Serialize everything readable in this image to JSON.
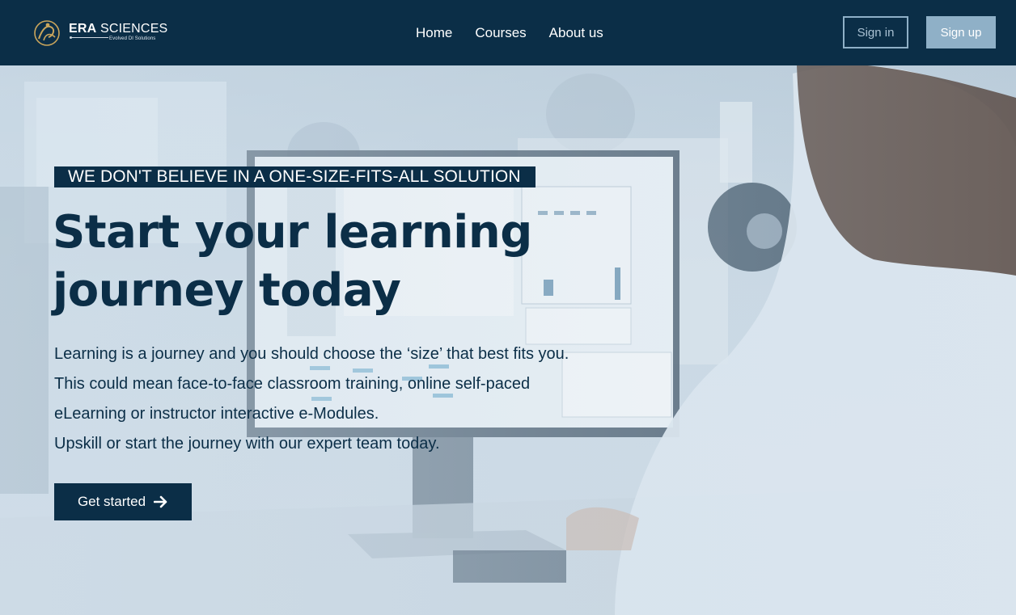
{
  "brand": {
    "name_bold": "ERA",
    "name_rest": " SCIENCES",
    "tagline": "Evolved DI Solutions"
  },
  "nav": {
    "links": [
      "Home",
      "Courses",
      "About us"
    ],
    "signin_label": "Sign in",
    "signup_label": "Sign up"
  },
  "hero": {
    "eyebrow": "WE DON'T BELIEVE IN A ONE-SIZE-FITS-ALL SOLUTION",
    "headline_line1": "Start your learning",
    "headline_line2": "journey today",
    "body_lines": [
      "Learning is a journey and you should choose the ‘size’ that best fits you.",
      "This could mean face-to-face classroom training, online self-paced",
      "eLearning or instructor interactive e-Modules.",
      "Upskill or start the journey with our expert team today."
    ],
    "cta_label": "Get started",
    "cta_icon": "arrow-right-icon"
  },
  "colors": {
    "primary": "#0b2e47",
    "accent": "#8fb0c7",
    "white": "#ffffff"
  }
}
